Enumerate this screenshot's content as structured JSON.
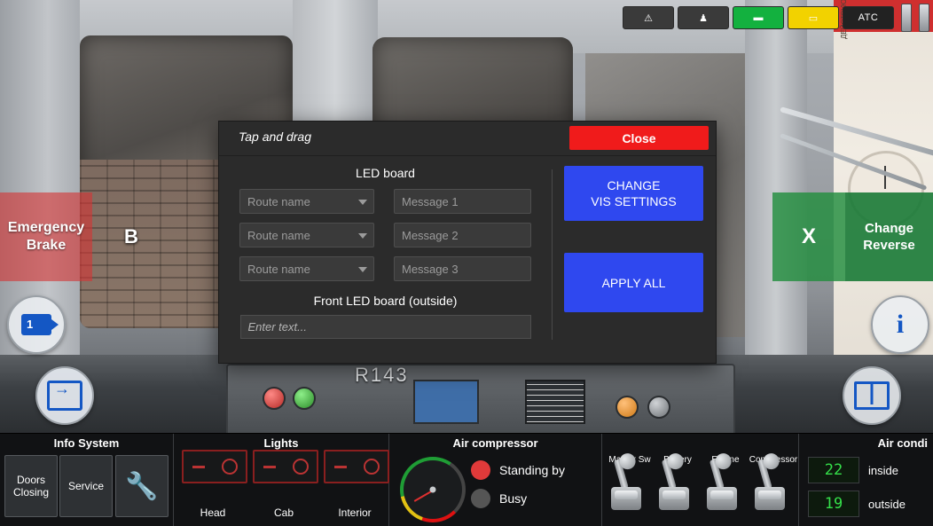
{
  "hud_top": {
    "buttons": [
      {
        "name": "warning",
        "label": "⚠",
        "style": "dark"
      },
      {
        "name": "horn",
        "label": "♟",
        "style": "dark"
      },
      {
        "name": "green-indicator",
        "label": "▬",
        "style": "green"
      },
      {
        "name": "yellow-indicator",
        "label": "▭",
        "style": "yellow"
      },
      {
        "name": "atc",
        "label": "ATC",
        "style": "atc"
      }
    ]
  },
  "hud_left": {
    "emergency_brake": "Emergency\nBrake",
    "brake_letter": "B",
    "camera_number": "1"
  },
  "hud_right": {
    "x_label": "X",
    "change_reverse": "Change\nReverse"
  },
  "dashboard": {
    "unit_number": "R143"
  },
  "modal": {
    "drag_hint": "Tap and drag",
    "close_label": "Close",
    "led_board_title": "LED board",
    "rows": [
      {
        "route_placeholder": "Route name",
        "message_placeholder": "Message 1"
      },
      {
        "route_placeholder": "Route name",
        "message_placeholder": "Message 2"
      },
      {
        "route_placeholder": "Route name",
        "message_placeholder": "Message 3"
      }
    ],
    "front_led_title": "Front LED board (outside)",
    "front_led_placeholder": "Enter text...",
    "change_vis_label": "CHANGE\nVIS SETTINGS",
    "apply_all_label": "APPLY ALL"
  },
  "bottom_bar": {
    "info_system": {
      "title": "Info System",
      "doors_closing": "Doors\nClosing",
      "service": "Service",
      "wrench_icon": "wrench-icon"
    },
    "lights": {
      "title": "Lights",
      "items": [
        {
          "label": "Head"
        },
        {
          "label": "Cab"
        },
        {
          "label": "Interior"
        }
      ]
    },
    "air_compressor": {
      "title": "Air compressor",
      "standing_by": "Standing by",
      "busy": "Busy",
      "active": "Standing by"
    },
    "switches": [
      {
        "label": "Master Sw"
      },
      {
        "label": "Battery"
      },
      {
        "label": "Engine"
      },
      {
        "label": "Compressor"
      }
    ],
    "air_conditioning": {
      "title": "Air condi",
      "inside_value": "22",
      "inside_label": "inside",
      "outside_value": "19",
      "outside_label": "outside"
    }
  },
  "poster": {
    "text": "ДЕЙСТВУЮЩИЕ ПРАВИЛА"
  },
  "colors": {
    "accent_blue": "#2f48ef",
    "close_red": "#f01b1b",
    "green": "#1a7a36",
    "emergency_red": "#d43535",
    "lcd_green": "#35e04a"
  }
}
